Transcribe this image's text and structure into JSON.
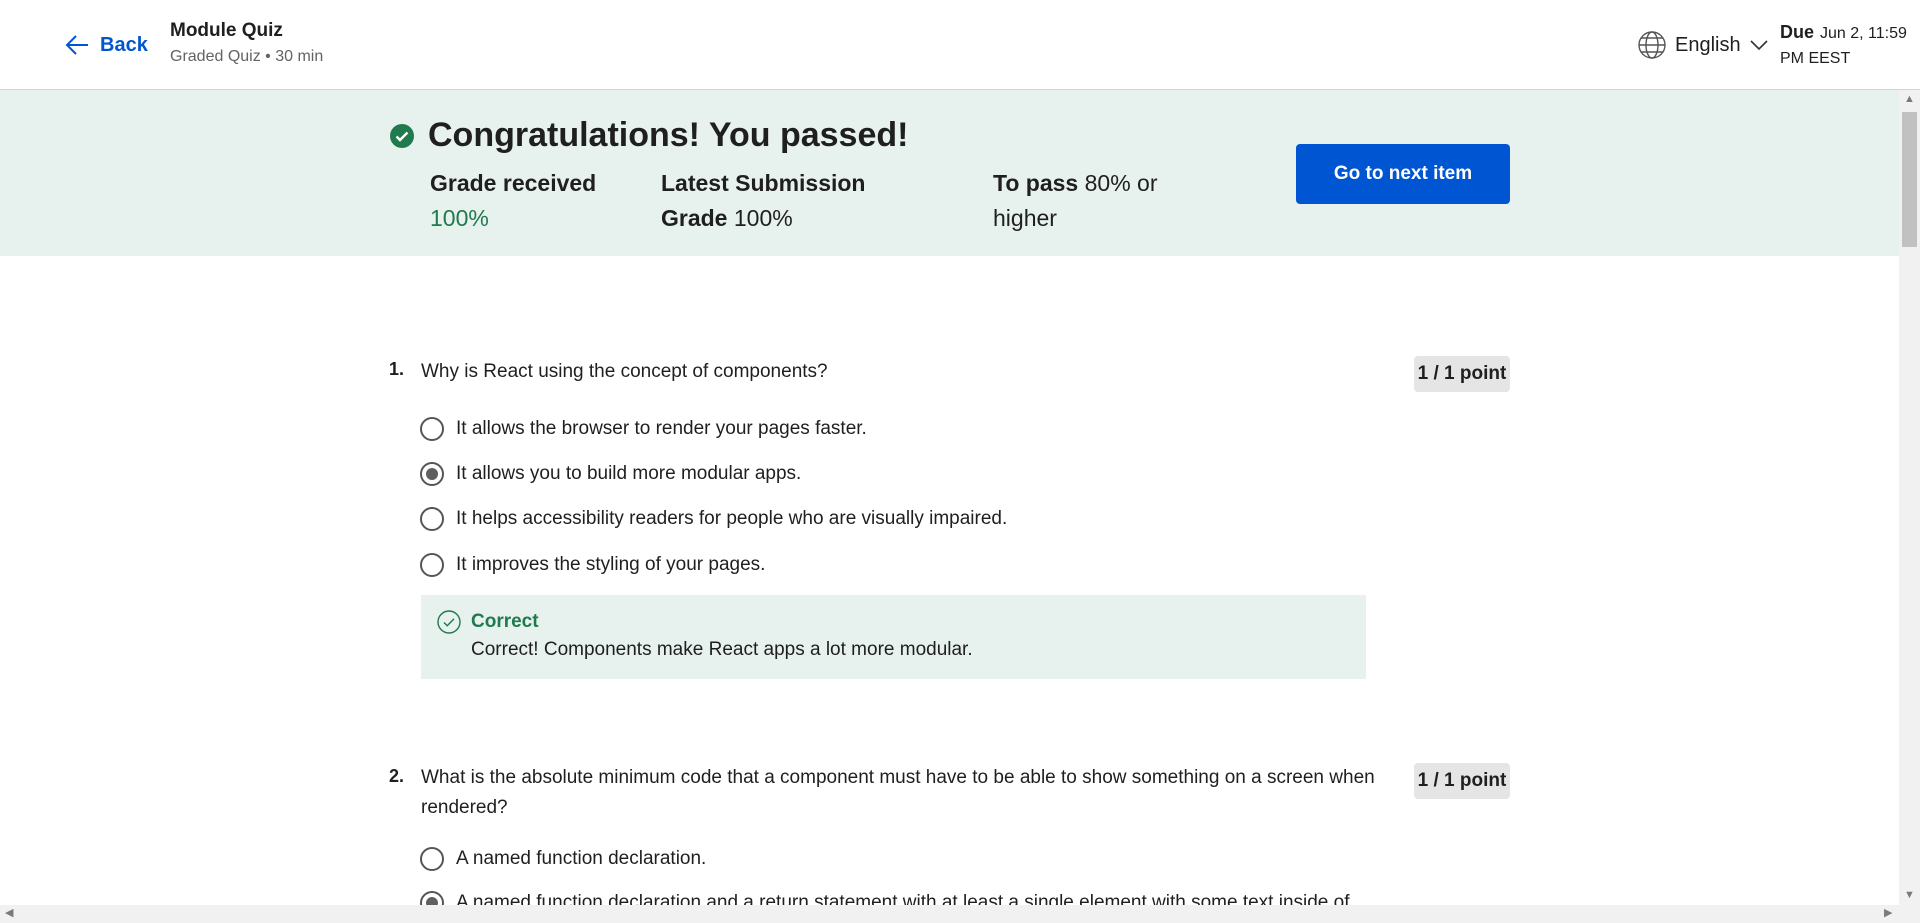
{
  "header": {
    "back_label": "Back",
    "title": "Module Quiz",
    "subtitle": "Graded Quiz • 30 min",
    "language": "English",
    "due_label": "Due",
    "due_value": "Jun 2, 11:59 PM EEST"
  },
  "banner": {
    "title": "Congratulations! You passed!",
    "grade_received_label": "Grade received",
    "grade_received_value": "100%",
    "latest_label": "Latest Submission Grade",
    "latest_value": "100%",
    "to_pass_label": "To pass",
    "to_pass_value": "80% or higher",
    "next_button": "Go to next item"
  },
  "questions": [
    {
      "number": "1.",
      "text": "Why is React using the concept of components?",
      "points": "1 / 1 point",
      "options": [
        {
          "label": "It allows the browser to render your pages faster.",
          "selected": false
        },
        {
          "label": "It allows you to build more modular apps.",
          "selected": true
        },
        {
          "label": "It helps accessibility readers for people who are visually impaired.",
          "selected": false
        },
        {
          "label": "It improves the styling of your pages.",
          "selected": false
        }
      ],
      "feedback": {
        "title": "Correct",
        "text": "Correct! Components make React apps a lot more modular."
      }
    },
    {
      "number": "2.",
      "text": "What is the absolute minimum code that a component must have to be able to show something on a screen when rendered?",
      "points": "1 / 1 point",
      "options": [
        {
          "label": "A named function declaration.",
          "selected": false
        },
        {
          "label": "A named function declaration and a return statement with at least a single element with some text inside of",
          "selected": true
        }
      ]
    }
  ],
  "colors": {
    "accent": "#0056d2",
    "success": "#1f7a4d",
    "banner_bg": "#e7f1ee"
  }
}
